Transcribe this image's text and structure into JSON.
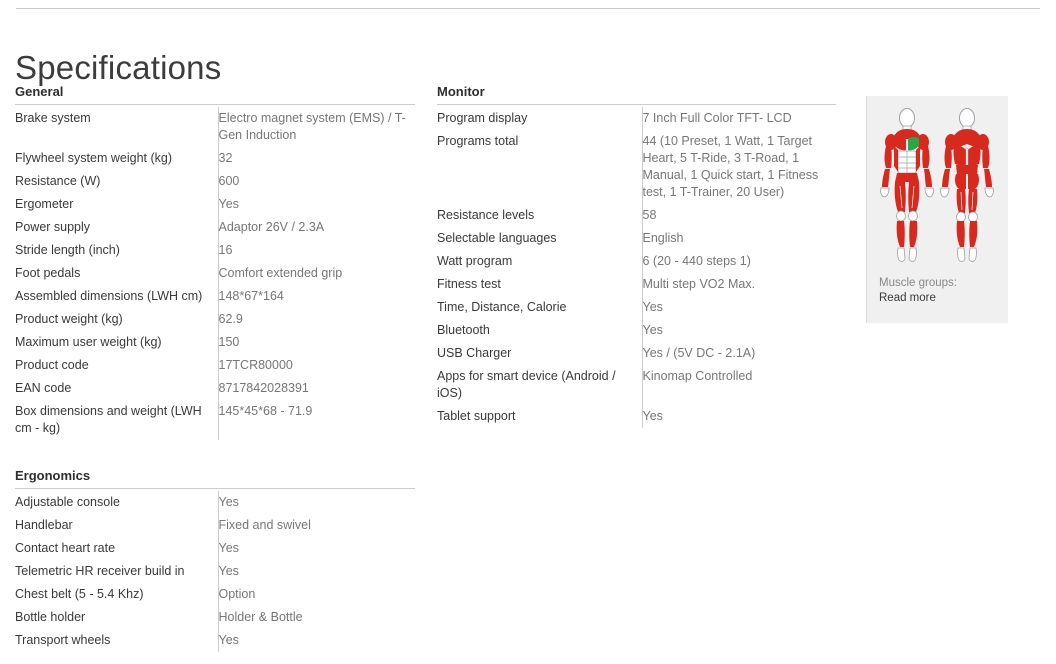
{
  "page": {
    "title": "Specifications"
  },
  "sections": [
    {
      "id": "general",
      "heading": "General",
      "rows": [
        {
          "label": "Brake system",
          "value": "Electro magnet system (EMS) / T-Gen Induction"
        },
        {
          "label": "Flywheel system weight (kg)",
          "value": "32"
        },
        {
          "label": "Resistance (W)",
          "value": "600"
        },
        {
          "label": "Ergometer",
          "value": "Yes"
        },
        {
          "label": "Power supply",
          "value": "Adaptor 26V / 2.3A"
        },
        {
          "label": "Stride length (inch)",
          "value": "16"
        },
        {
          "label": "Foot pedals",
          "value": "Comfort extended grip"
        },
        {
          "label": "Assembled dimensions (LWH cm)",
          "value": "148*67*164"
        },
        {
          "label": "Product weight (kg)",
          "value": "62.9"
        },
        {
          "label": "Maximum user weight (kg)",
          "value": "150"
        },
        {
          "label": "Product code",
          "value": "17TCR80000"
        },
        {
          "label": "EAN code",
          "value": "8717842028391"
        },
        {
          "label": "Box dimensions and weight (LWH cm - kg)",
          "value": "145*45*68 - 71.9"
        }
      ]
    },
    {
      "id": "ergonomics",
      "heading": "Ergonomics",
      "rows": [
        {
          "label": "Adjustable console",
          "value": "Yes"
        },
        {
          "label": "Handlebar",
          "value": "Fixed and swivel"
        },
        {
          "label": "Contact heart rate",
          "value": "Yes"
        },
        {
          "label": "Telemetric HR receiver build in",
          "value": "Yes"
        },
        {
          "label": "Chest belt (5 - 5.4 Khz)",
          "value": "Option"
        },
        {
          "label": "Bottle holder",
          "value": "Holder & Bottle"
        },
        {
          "label": "Transport wheels",
          "value": "Yes"
        }
      ]
    },
    {
      "id": "monitor",
      "heading": "Monitor",
      "rows": [
        {
          "label": "Program display",
          "value": "7 Inch Full Color TFT- LCD"
        },
        {
          "label": "Programs total",
          "value": "44 (10 Preset, 1 Watt, 1 Target Heart, 5 T-Ride, 3 T-Road, 1 Manual, 1 Quick start, 1 Fitness test, 1 T-Trainer, 20 User)"
        },
        {
          "label": "Resistance levels",
          "value": "58"
        },
        {
          "label": "Selectable languages",
          "value": "English"
        },
        {
          "label": "Watt program",
          "value": "6 (20 - 440 steps 1)"
        },
        {
          "label": "Fitness test",
          "value": "Multi step VO2 Max."
        },
        {
          "label": "Time, Distance, Calorie",
          "value": "Yes"
        },
        {
          "label": "Bluetooth",
          "value": "Yes"
        },
        {
          "label": "USB Charger",
          "value": "Yes / (5V DC - 2.1A)"
        },
        {
          "label": "Apps for smart device (Android / iOS)",
          "value": "Kinomap Controlled"
        },
        {
          "label": "Tablet support",
          "value": "Yes"
        }
      ]
    }
  ],
  "muscle_panel": {
    "caption_label": "Muscle groups:",
    "read_more": "Read more",
    "icon": "muscle-anatomy-front-back",
    "colors": {
      "muscle_active": "#d8291e",
      "muscle_highlight": "#29a745",
      "body_outline": "#9aa0a6",
      "panel_background": "#f0f0f1"
    }
  }
}
